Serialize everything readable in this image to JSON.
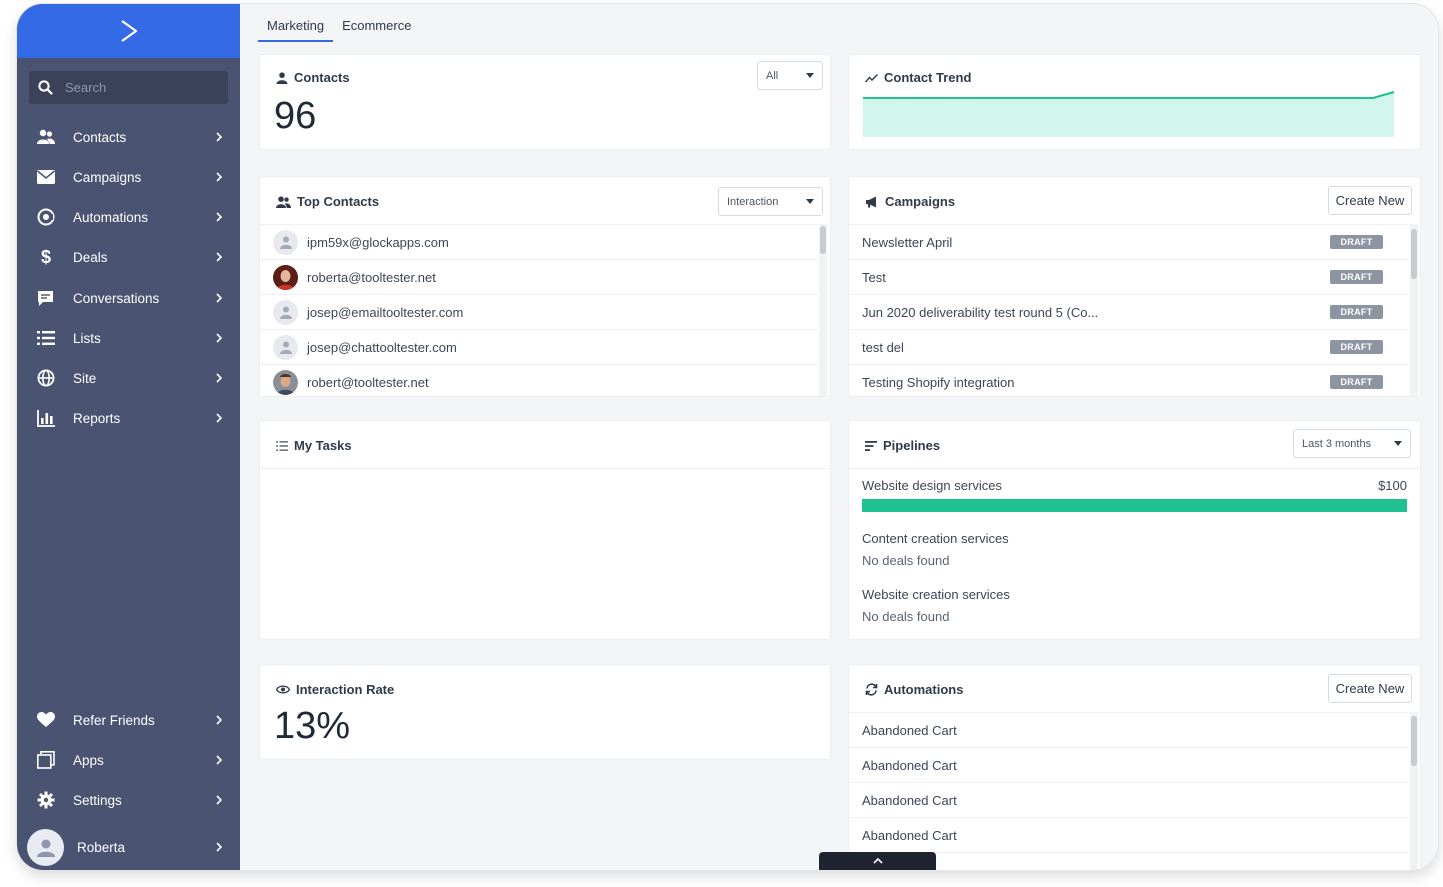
{
  "sidebar": {
    "search_placeholder": "Search",
    "nav": [
      {
        "label": "Contacts",
        "icon": "contacts-icon"
      },
      {
        "label": "Campaigns",
        "icon": "envelope-icon"
      },
      {
        "label": "Automations",
        "icon": "automations-icon"
      },
      {
        "label": "Deals",
        "icon": "dollar-icon"
      },
      {
        "label": "Conversations",
        "icon": "chat-icon"
      },
      {
        "label": "Lists",
        "icon": "list-icon"
      },
      {
        "label": "Site",
        "icon": "globe-icon"
      },
      {
        "label": "Reports",
        "icon": "bar-chart-icon"
      }
    ],
    "bottom_nav": [
      {
        "label": "Refer Friends",
        "icon": "heart-icon"
      },
      {
        "label": "Apps",
        "icon": "apps-icon"
      },
      {
        "label": "Settings",
        "icon": "gear-icon"
      }
    ],
    "user": {
      "name": "Roberta"
    }
  },
  "tabs": [
    {
      "label": "Marketing",
      "active": true
    },
    {
      "label": "Ecommerce",
      "active": false
    }
  ],
  "contacts_card": {
    "title": "Contacts",
    "filter": "All",
    "count": "96"
  },
  "contact_trend_card": {
    "title": "Contact Trend"
  },
  "top_contacts": {
    "title": "Top Contacts",
    "sort": "Interaction",
    "rows": [
      {
        "email": "ipm59x@glockapps.com",
        "avatar": "default"
      },
      {
        "email": "roberta@tooltester.net",
        "avatar": "photo"
      },
      {
        "email": "josep@emailtooltester.com",
        "avatar": "default"
      },
      {
        "email": "josep@chattooltester.com",
        "avatar": "default"
      },
      {
        "email": "robert@tooltester.net",
        "avatar": "photo"
      }
    ]
  },
  "campaigns": {
    "title": "Campaigns",
    "create_label": "Create New",
    "rows": [
      {
        "name": "Newsletter April",
        "status": "DRAFT"
      },
      {
        "name": "Test",
        "status": "DRAFT"
      },
      {
        "name": "Jun 2020 deliverability test round 5 (Co...",
        "status": "DRAFT"
      },
      {
        "name": "test del",
        "status": "DRAFT"
      },
      {
        "name": "Testing Shopify integration",
        "status": "DRAFT"
      }
    ]
  },
  "my_tasks": {
    "title": "My Tasks"
  },
  "pipelines": {
    "title": "Pipelines",
    "range": "Last 3 months",
    "items": [
      {
        "name": "Website design services",
        "amount": "$100",
        "fill": 1.0
      },
      {
        "name": "Content creation services",
        "note": "No deals found"
      },
      {
        "name": "Website creation services",
        "note": "No deals found"
      }
    ]
  },
  "interaction_rate": {
    "title": "Interaction Rate",
    "value": "13%"
  },
  "automations": {
    "title": "Automations",
    "create_label": "Create New",
    "rows": [
      {
        "name": "Abandoned Cart"
      },
      {
        "name": "Abandoned Cart"
      },
      {
        "name": "Abandoned Cart"
      },
      {
        "name": "Abandoned Cart"
      }
    ]
  },
  "colors": {
    "sidebar": "#4b5372",
    "brand_blue": "#356ae6",
    "accent_green": "#1fc190",
    "trend_fill": "#d2f6ec",
    "draft_badge": "#8d95a3"
  }
}
